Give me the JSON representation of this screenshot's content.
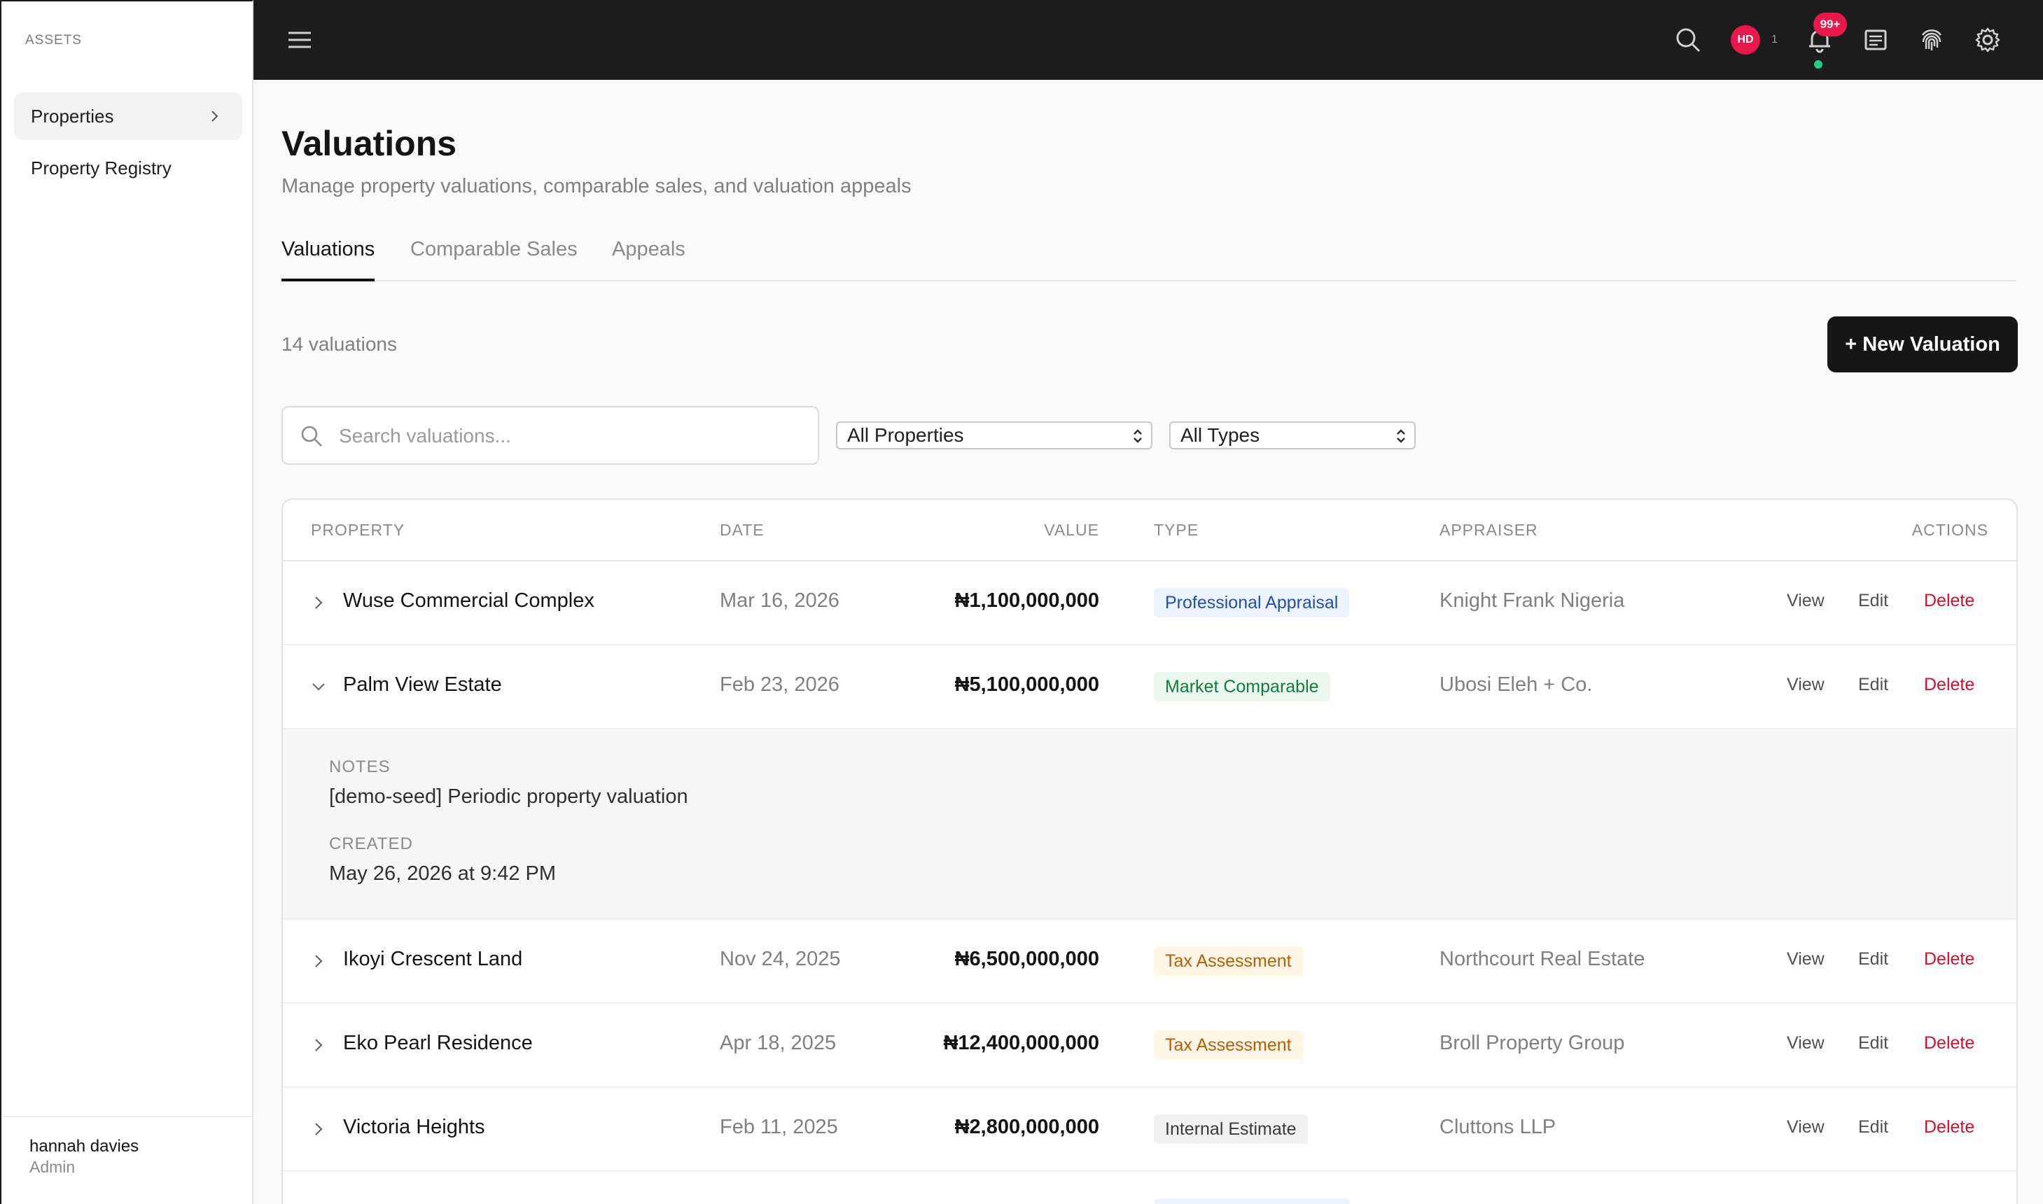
{
  "sidebar": {
    "section_label": "ASSETS",
    "items": [
      {
        "label": "Properties"
      },
      {
        "label": "Property Registry"
      }
    ],
    "user": {
      "name": "hannah davies",
      "role": "Admin"
    }
  },
  "topbar": {
    "avatar_initials": "HD",
    "avatar_count": "1",
    "notifications_badge": "99+",
    "icons": [
      "menu-icon",
      "search-icon",
      "bell-icon",
      "document-icon",
      "fingerprint-icon",
      "gear-icon"
    ]
  },
  "page": {
    "title": "Valuations",
    "subtitle": "Manage property valuations, comparable sales, and valuation appeals",
    "tabs": [
      {
        "label": "Valuations",
        "active": true
      },
      {
        "label": "Comparable Sales",
        "active": false
      },
      {
        "label": "Appeals",
        "active": false
      }
    ],
    "count_text": "14 valuations",
    "new_button": "+ New Valuation"
  },
  "filters": {
    "search_placeholder": "Search valuations...",
    "property_select": "All Properties",
    "type_select": "All Types"
  },
  "table": {
    "headers": {
      "property": "PROPERTY",
      "date": "DATE",
      "value": "VALUE",
      "type": "TYPE",
      "appraiser": "APPRAISER",
      "actions": "ACTIONS"
    },
    "action_labels": {
      "view": "View",
      "edit": "Edit",
      "delete": "Delete"
    },
    "rows": [
      {
        "property": "Wuse Commercial Complex",
        "date": "Mar 16, 2026",
        "value": "₦1,100,000,000",
        "type": "Professional Appraisal",
        "appraiser": "Knight Frank Nigeria"
      },
      {
        "property": "Palm View Estate",
        "date": "Feb 23, 2026",
        "value": "₦5,100,000,000",
        "type": "Market Comparable",
        "appraiser": "Ubosi Eleh + Co."
      },
      {
        "property": "Ikoyi Crescent Land",
        "date": "Nov 24, 2025",
        "value": "₦6,500,000,000",
        "type": "Tax Assessment",
        "appraiser": "Northcourt Real Estate"
      },
      {
        "property": "Eko Pearl Residence",
        "date": "Apr 18, 2025",
        "value": "₦12,400,000,000",
        "type": "Tax Assessment",
        "appraiser": "Broll Property Group"
      },
      {
        "property": "Victoria Heights",
        "date": "Feb 11, 2025",
        "value": "₦2,800,000,000",
        "type": "Internal Estimate",
        "appraiser": "Cluttons LLP"
      }
    ],
    "expanded_detail": {
      "notes_label": "NOTES",
      "notes_value": "[demo-seed] Periodic property valuation",
      "created_label": "CREATED",
      "created_value": "May 26, 2026 at 9:42 PM"
    }
  },
  "colors": {
    "accent_red": "#e8194a",
    "delete_red": "#d20f2f",
    "badge_professional_bg": "#eef4ff",
    "badge_professional_fg": "#1f4fb5",
    "badge_market_bg": "#eaf8ef",
    "badge_market_fg": "#157a3c",
    "badge_tax_bg": "#fff6e6",
    "badge_tax_fg": "#b4600a",
    "badge_internal_bg": "#f1f1f1",
    "badge_internal_fg": "#3a3a3a"
  }
}
